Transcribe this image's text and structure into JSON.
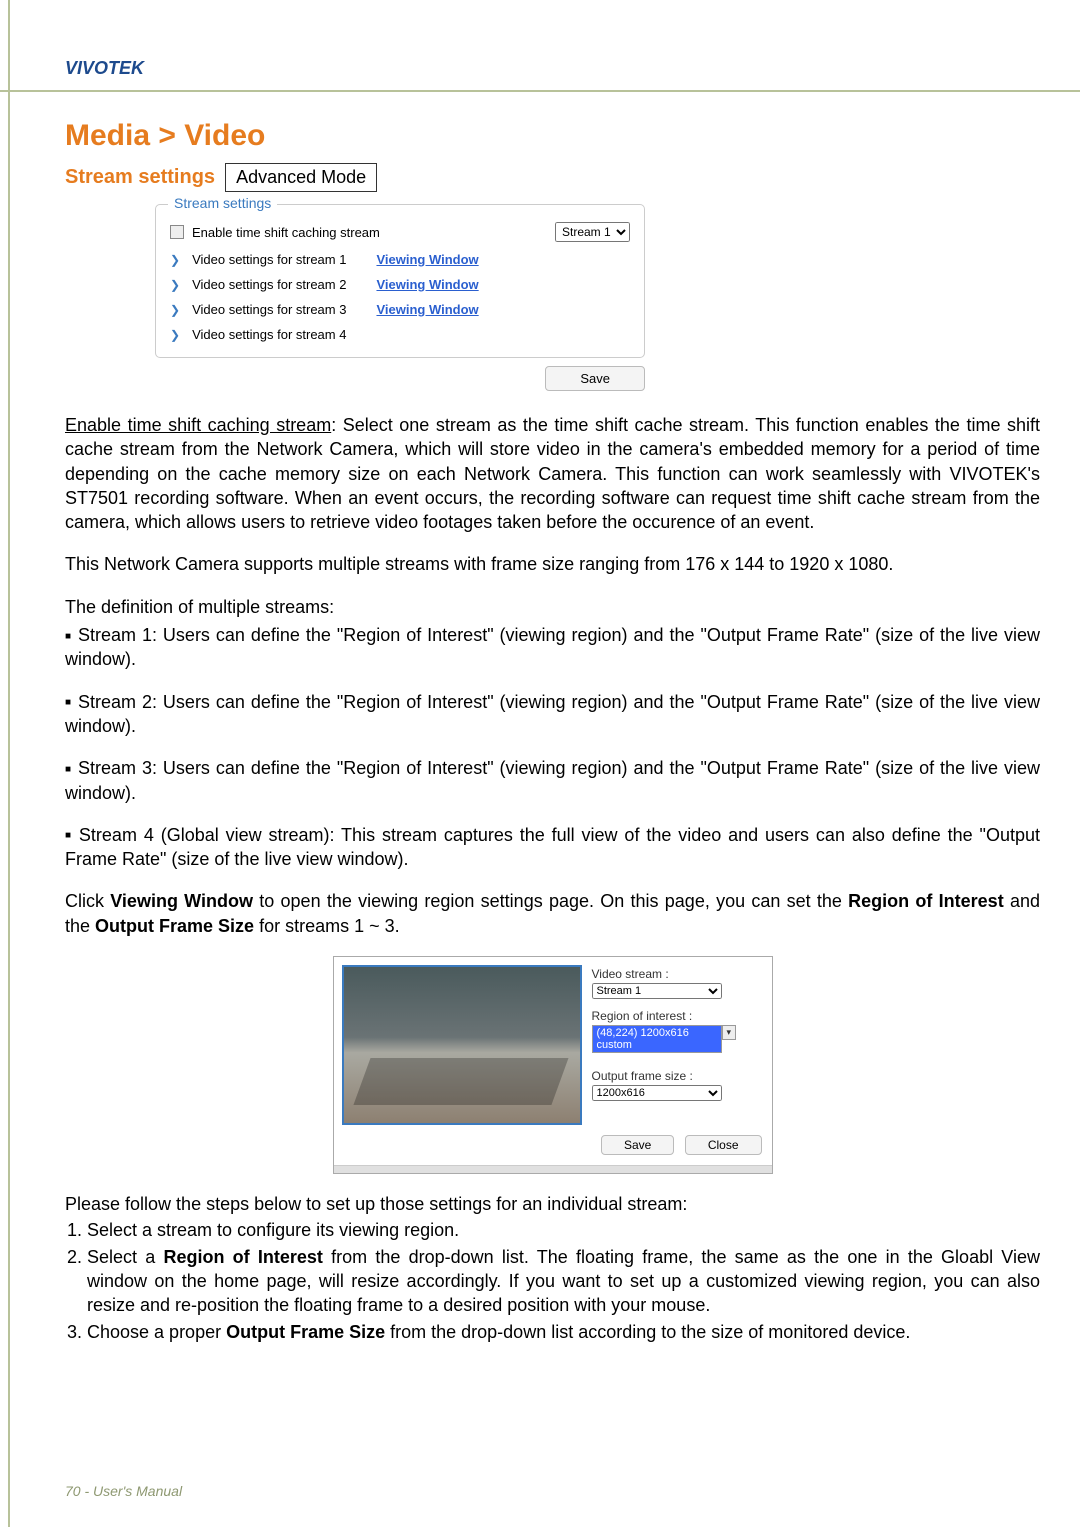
{
  "brand": "VIVOTEK",
  "title": "Media > Video",
  "subtitle": "Stream settings",
  "adv_mode": "Advanced Mode",
  "fieldset": {
    "legend": "Stream settings",
    "enable_label": "Enable time shift caching stream",
    "stream_select": "Stream 1",
    "rows": [
      {
        "label": "Video settings for stream 1",
        "link": "Viewing Window"
      },
      {
        "label": "Video settings for stream 2",
        "link": "Viewing Window"
      },
      {
        "label": "Video settings for stream 3",
        "link": "Viewing Window"
      },
      {
        "label": "Video settings for stream 4",
        "link": ""
      }
    ],
    "save": "Save"
  },
  "p_enable_u": "Enable time shift caching stream",
  "p_enable_rest": ": Select one stream as the time shift cache stream. This function enables the time shift cache stream from the Network Camera, which will store video in the camera's embedded memory for a period of time depending on the cache memory size on each Network Camera. This function can work seamlessly with VIVOTEK's ST7501 recording software. When an event occurs, the recording software can request time shift cache stream from the camera, which allows users to retrieve video footages taken before the occurence of an event.",
  "p_multi": "This Network Camera supports multiple streams with frame size ranging from 176 x 144 to 1920 x 1080.",
  "p_def": "The definition of multiple streams:",
  "streams": [
    "Stream 1: Users can define the \"Region of Interest\" (viewing region) and the \"Output Frame Rate\" (size of the live view window).",
    "Stream 2: Users can define the \"Region of Interest\" (viewing region) and the \"Output Frame Rate\" (size of the live view window).",
    "Stream 3: Users can define the \"Region of Interest\" (viewing region) and the \"Output Frame Rate\" (size of the live view window).",
    "Stream 4 (Global view stream): This stream captures the full view of the video and users can also define the \"Output Frame Rate\" (size of the live view window)."
  ],
  "p_click_1": "Click ",
  "p_click_b1": "Viewing Window",
  "p_click_2": " to open the viewing region settings page. On this page, you can set the ",
  "p_click_b2": "Region of Interest",
  "p_click_3": " and the ",
  "p_click_b3": "Output Frame Size",
  "p_click_4": " for streams 1 ~ 3.",
  "vw": {
    "video_stream_lbl": "Video stream :",
    "video_stream_val": "Stream 1",
    "roi_lbl": "Region of interest :",
    "roi_val": "(48,224) 1200x616 custom",
    "ofs_lbl": "Output frame size :",
    "ofs_val": "1200x616",
    "save": "Save",
    "close": "Close"
  },
  "p_follow": "Please follow the steps below to set up those settings for an individual stream:",
  "steps": {
    "s1": "Select a stream to configure its viewing region.",
    "s2a": "Select a ",
    "s2b": "Region of Interest",
    "s2c": " from the drop-down list. The floating frame, the same as the one in the Gloabl View window on the home page, will resize accordingly. If you want to set up a customized viewing region, you can also resize and re-position the floating frame to a desired position with your mouse.",
    "s3a": "Choose a proper ",
    "s3b": "Output Frame Size",
    "s3c": " from the drop-down list according to the size of monitored device."
  },
  "footer": "70 - User's Manual"
}
